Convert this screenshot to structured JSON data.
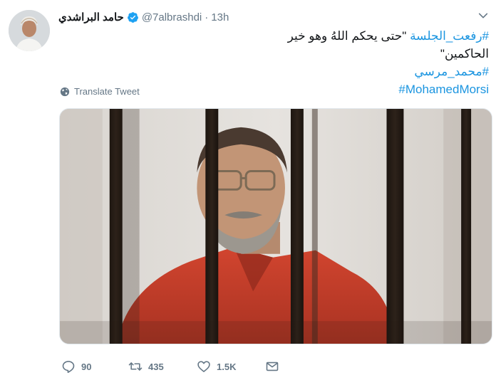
{
  "tweet": {
    "author": {
      "display_name": "حامد البراشدي",
      "verified": true,
      "handle": "@7albrashdi",
      "separator": "·",
      "time": "13h"
    },
    "text": {
      "line1_hashtag": "#رفعت_الجلسة",
      "line1_quote": " \"حتى يحكم اللهُ وهو خير الحاكمين\"",
      "line2_hashtag": "#محمد_مرسي",
      "line3_hashtag": "#MohamedMorsi"
    },
    "translate_label": "Translate Tweet",
    "actions": {
      "reply_count": "90",
      "retweet_count": "435",
      "like_count": "1.5K"
    },
    "icons": {
      "verified": "verified-badge-icon",
      "caret": "chevron-down-icon",
      "translate": "globe-icon",
      "reply": "reply-icon",
      "retweet": "retweet-icon",
      "like": "heart-icon",
      "dm": "envelope-icon"
    },
    "colors": {
      "hashtag": "#1b95e0",
      "secondary_text": "#657786",
      "verified": "#1da1f2"
    }
  }
}
